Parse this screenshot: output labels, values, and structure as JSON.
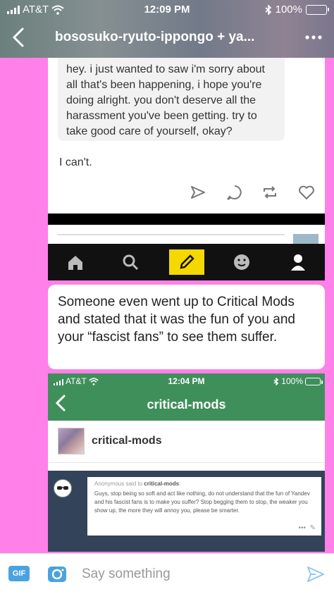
{
  "status_bar": {
    "carrier": "AT&T",
    "time": "12:09 PM",
    "battery": "100%"
  },
  "header": {
    "title": "bososuko-ryuto-ippongo + ya..."
  },
  "screenshot1": {
    "message": "hey. i just wanted to saw i'm sorry about all that's been happening, i hope you're doing alright. you don't deserve all the harassment you've been getting. try to take good care of yourself, okay?",
    "reply": "I can't.",
    "actions": [
      "send-icon",
      "comment-icon",
      "reblog-icon",
      "heart-icon"
    ],
    "tabs": [
      "home-icon",
      "search-icon",
      "compose-icon",
      "emoji-icon",
      "person-icon"
    ],
    "compose_color": "#f5d800"
  },
  "text_message": "Someone even went up to Critical Mods and stated that it was the fun of you and your “fascist fans” to see them suffer.",
  "screenshot2": {
    "status_bar": {
      "carrier": "AT&T",
      "time": "12:04 PM",
      "battery": "100%"
    },
    "title": "critical-mods",
    "blog_name": "critical-mods",
    "ask_sender": "Anonymous said to",
    "ask_recipient": "critical-mods",
    "ask_text": "Guys, stop being so soft and act like nothing, do not understand that the fun of Yandev and his fascist fans is to make you suffer? Stop begging them to stop, the weaker you show up, the more they will annoy you, please be smarter.",
    "header_color": "#3f8f5b"
  },
  "composer": {
    "gif_label": "GIF",
    "placeholder": "Say something"
  },
  "colors": {
    "background": "#ff80e8",
    "accent_blue": "#4aa3df"
  }
}
